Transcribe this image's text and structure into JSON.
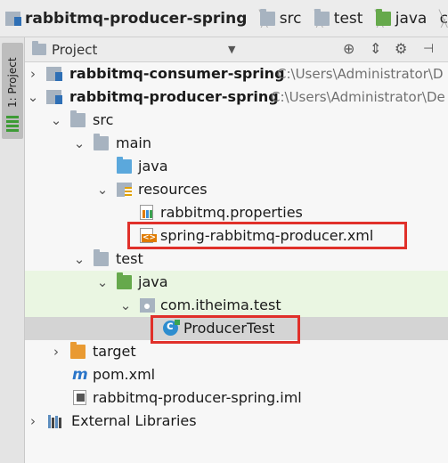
{
  "breadcrumb": [
    {
      "label": "rabbitmq-producer-spring",
      "icon": "module-folder-icon"
    },
    {
      "label": "src",
      "icon": "folder-icon"
    },
    {
      "label": "test",
      "icon": "folder-icon"
    },
    {
      "label": "java",
      "icon": "green-folder-icon"
    },
    {
      "label": "c"
    }
  ],
  "tool_strip": {
    "tab_label": "1: Project"
  },
  "panel": {
    "title": "Project",
    "tools": [
      "target-icon",
      "split-icon",
      "gear-icon",
      "hide-icon"
    ]
  },
  "tree": [
    {
      "label": "rabbitmq-consumer-spring",
      "path": "C:\\Users\\Administrator\\D",
      "bold": true,
      "icon": "module-icon",
      "arrow": "collapsed"
    },
    {
      "label": "rabbitmq-producer-spring",
      "path": "C:\\Users\\Administrator\\De",
      "bold": true,
      "icon": "module-icon",
      "arrow": "expanded"
    },
    {
      "label": "src",
      "icon": "folder-icon",
      "arrow": "expanded"
    },
    {
      "label": "main",
      "icon": "folder-icon",
      "arrow": "expanded"
    },
    {
      "label": "java",
      "icon": "blue-folder-icon",
      "arrow": "none"
    },
    {
      "label": "resources",
      "icon": "resources-folder-icon",
      "arrow": "expanded"
    },
    {
      "label": "rabbitmq.properties",
      "icon": "properties-file-icon",
      "arrow": "none"
    },
    {
      "label": "spring-rabbitmq-producer.xml",
      "icon": "xml-file-icon",
      "arrow": "none",
      "highlighted": true
    },
    {
      "label": "test",
      "icon": "folder-icon",
      "arrow": "expanded"
    },
    {
      "label": "java",
      "icon": "green-folder-icon",
      "arrow": "expanded",
      "state": "test-source"
    },
    {
      "label": "com.itheima.test",
      "icon": "package-icon",
      "arrow": "expanded",
      "state": "test-source"
    },
    {
      "label": "ProducerTest",
      "icon": "class-icon",
      "arrow": "none",
      "state": "selected",
      "highlighted": true
    },
    {
      "label": "target",
      "icon": "orange-folder-icon",
      "arrow": "collapsed"
    },
    {
      "label": "pom.xml",
      "icon": "maven-icon",
      "arrow": "none"
    },
    {
      "label": "rabbitmq-producer-spring.iml",
      "icon": "iml-file-icon",
      "arrow": "none"
    },
    {
      "label": "External Libraries",
      "icon": "libraries-icon",
      "arrow": "collapsed"
    }
  ],
  "colors": {
    "test_source_bg": "#eaf6e2",
    "selected_bg": "#d4d4d4",
    "highlight_box": "#e0302a"
  }
}
